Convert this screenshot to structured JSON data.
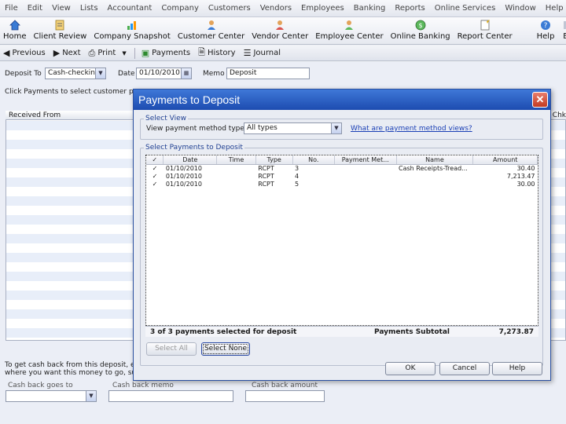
{
  "menubar": [
    "File",
    "Edit",
    "View",
    "Lists",
    "Accountant",
    "Company",
    "Customers",
    "Vendors",
    "Employees",
    "Banking",
    "Reports",
    "Online Services",
    "Window",
    "Help"
  ],
  "iconbar": [
    {
      "label": "Home",
      "icon": "home-icon"
    },
    {
      "label": "Client Review",
      "icon": "client-review-icon"
    },
    {
      "label": "Company Snapshot",
      "icon": "company-snapshot-icon"
    },
    {
      "label": "Customer Center",
      "icon": "customer-center-icon"
    },
    {
      "label": "Vendor Center",
      "icon": "vendor-center-icon"
    },
    {
      "label": "Employee Center",
      "icon": "employee-center-icon"
    },
    {
      "label": "Online Banking",
      "icon": "online-banking-icon"
    },
    {
      "label": "Report Center",
      "icon": "report-center-icon"
    },
    {
      "label": "Help",
      "icon": "help-icon"
    },
    {
      "label": "Ea",
      "icon": "ea-icon"
    }
  ],
  "toolbar": {
    "previous": "Previous",
    "next": "Next",
    "print": "Print",
    "payments": "Payments",
    "history": "History",
    "journal": "Journal"
  },
  "form": {
    "deposit_to_label": "Deposit To",
    "deposit_to_value": "Cash-checking",
    "date_label": "Date",
    "date_value": "01/10/2010",
    "memo_label": "Memo",
    "memo_value": "Deposit",
    "instructions": "Click Payments to select customer payme",
    "grid_header": "Received From",
    "grid_header_right": "Chk",
    "cash_back_text_1": "To get cash back from this deposit, ente",
    "cash_back_text_2": "where you want this money to go, such",
    "cash_back_goes_to": "Cash back goes to",
    "cash_back_memo": "Cash back memo",
    "cash_back_amount": "Cash back amount"
  },
  "dialog": {
    "title": "Payments to Deposit",
    "select_view_title": "Select View",
    "view_type_label": "View payment method type",
    "view_type_value": "All types",
    "view_link": "What are payment method views?",
    "select_payments_title": "Select Payments to Deposit",
    "columns": [
      "✓",
      "Date",
      "Time",
      "Type",
      "No.",
      "Payment Met...",
      "Name",
      "Amount"
    ],
    "rows": [
      {
        "check": "✓",
        "date": "01/10/2010",
        "time": "",
        "type": "RCPT",
        "no": "3",
        "method": "",
        "name": "Cash Receipts-Tread...",
        "amount": "30.40"
      },
      {
        "check": "✓",
        "date": "01/10/2010",
        "time": "",
        "type": "RCPT",
        "no": "4",
        "method": "",
        "name": "",
        "amount": "7,213.47"
      },
      {
        "check": "✓",
        "date": "01/10/2010",
        "time": "",
        "type": "RCPT",
        "no": "5",
        "method": "",
        "name": "",
        "amount": "30.00"
      }
    ],
    "selected_count": "3 of 3 payments selected for deposit",
    "subtotal_label": "Payments Subtotal",
    "subtotal_value": "7,273.87",
    "select_all": "Select All",
    "select_none": "Select None",
    "ok": "OK",
    "cancel": "Cancel",
    "help": "Help"
  },
  "colors": {
    "title_bar": "#1d4cb0",
    "close_button": "#c23b22",
    "link": "#1a3fb5"
  }
}
